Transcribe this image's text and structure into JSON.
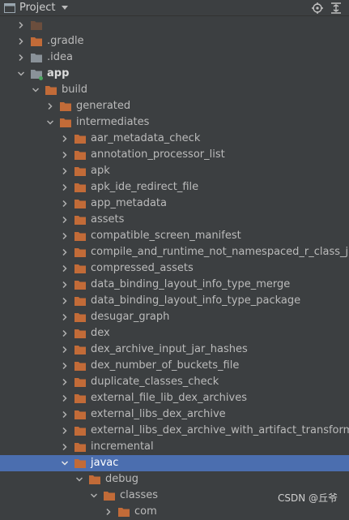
{
  "header": {
    "title": "Project",
    "icons": [
      "project-icon",
      "chevron-down-icon",
      "locate-icon",
      "collapse-all-icon"
    ]
  },
  "colors": {
    "background": "#3c3f41",
    "selected": "#4b6eaf",
    "folder_orange": "#c26b38",
    "folder_gray": "#8a9299",
    "module_dot": "#4aa65f"
  },
  "tree": [
    {
      "label": "",
      "depth": 0,
      "expanded": false,
      "type": "folder",
      "faded": true
    },
    {
      "label": ".gradle",
      "depth": 0,
      "expanded": false,
      "type": "folder"
    },
    {
      "label": ".idea",
      "depth": 0,
      "expanded": false,
      "type": "folder-gray"
    },
    {
      "label": "app",
      "depth": 0,
      "expanded": true,
      "type": "module",
      "bold": true
    },
    {
      "label": "build",
      "depth": 1,
      "expanded": true,
      "type": "folder"
    },
    {
      "label": "generated",
      "depth": 2,
      "expanded": false,
      "type": "folder"
    },
    {
      "label": "intermediates",
      "depth": 2,
      "expanded": true,
      "type": "folder"
    },
    {
      "label": "aar_metadata_check",
      "depth": 3,
      "expanded": false,
      "type": "folder"
    },
    {
      "label": "annotation_processor_list",
      "depth": 3,
      "expanded": false,
      "type": "folder"
    },
    {
      "label": "apk",
      "depth": 3,
      "expanded": false,
      "type": "folder"
    },
    {
      "label": "apk_ide_redirect_file",
      "depth": 3,
      "expanded": false,
      "type": "folder"
    },
    {
      "label": "app_metadata",
      "depth": 3,
      "expanded": false,
      "type": "folder"
    },
    {
      "label": "assets",
      "depth": 3,
      "expanded": false,
      "type": "folder"
    },
    {
      "label": "compatible_screen_manifest",
      "depth": 3,
      "expanded": false,
      "type": "folder"
    },
    {
      "label": "compile_and_runtime_not_namespaced_r_class_jar",
      "depth": 3,
      "expanded": false,
      "type": "folder"
    },
    {
      "label": "compressed_assets",
      "depth": 3,
      "expanded": false,
      "type": "folder"
    },
    {
      "label": "data_binding_layout_info_type_merge",
      "depth": 3,
      "expanded": false,
      "type": "folder"
    },
    {
      "label": "data_binding_layout_info_type_package",
      "depth": 3,
      "expanded": false,
      "type": "folder"
    },
    {
      "label": "desugar_graph",
      "depth": 3,
      "expanded": false,
      "type": "folder"
    },
    {
      "label": "dex",
      "depth": 3,
      "expanded": false,
      "type": "folder"
    },
    {
      "label": "dex_archive_input_jar_hashes",
      "depth": 3,
      "expanded": false,
      "type": "folder"
    },
    {
      "label": "dex_number_of_buckets_file",
      "depth": 3,
      "expanded": false,
      "type": "folder"
    },
    {
      "label": "duplicate_classes_check",
      "depth": 3,
      "expanded": false,
      "type": "folder"
    },
    {
      "label": "external_file_lib_dex_archives",
      "depth": 3,
      "expanded": false,
      "type": "folder"
    },
    {
      "label": "external_libs_dex_archive",
      "depth": 3,
      "expanded": false,
      "type": "folder"
    },
    {
      "label": "external_libs_dex_archive_with_artifact_transforms",
      "depth": 3,
      "expanded": false,
      "type": "folder"
    },
    {
      "label": "incremental",
      "depth": 3,
      "expanded": false,
      "type": "folder"
    },
    {
      "label": "javac",
      "depth": 3,
      "expanded": true,
      "type": "folder",
      "selected": true
    },
    {
      "label": "debug",
      "depth": 4,
      "expanded": true,
      "type": "folder"
    },
    {
      "label": "classes",
      "depth": 5,
      "expanded": true,
      "type": "folder"
    },
    {
      "label": "com",
      "depth": 6,
      "expanded": false,
      "type": "folder"
    }
  ],
  "watermark": "CSDN @丘爷"
}
